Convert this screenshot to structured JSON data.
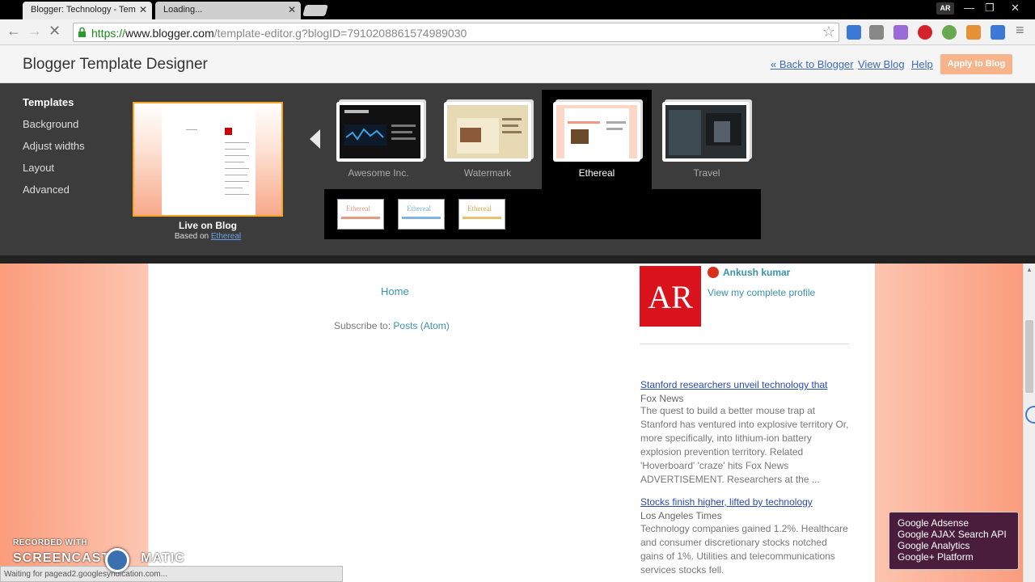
{
  "browser": {
    "tabs": [
      {
        "title": "Blogger: Technology - Tem"
      },
      {
        "title": "Loading..."
      }
    ],
    "profile": "AR",
    "url_scheme": "https://",
    "url_host": "www.blogger.com",
    "url_path": "/template-editor.g?blogID=7910208861574989030",
    "status": "Waiting for pagead2.googlesyndication.com..."
  },
  "header": {
    "title": "Blogger Template Designer",
    "back_link": "« Back to Blogger",
    "view_blog": "View Blog",
    "help": "Help",
    "apply": "Apply to Blog"
  },
  "sidebar": {
    "items": [
      {
        "label": "Templates"
      },
      {
        "label": "Background"
      },
      {
        "label": "Adjust widths"
      },
      {
        "label": "Layout"
      },
      {
        "label": "Advanced"
      }
    ]
  },
  "live": {
    "label": "Live on Blog",
    "based_prefix": "Based on",
    "based_link": "Ethereal"
  },
  "templates": [
    {
      "name": "Awesome Inc."
    },
    {
      "name": "Watermark"
    },
    {
      "name": "Ethereal"
    },
    {
      "name": "Travel"
    }
  ],
  "variants": [
    {
      "label": "Ethereal",
      "color": "#e79a83"
    },
    {
      "label": "Ethereal",
      "color": "#7fb4df"
    },
    {
      "label": "Ethereal",
      "color": "#e9c270"
    }
  ],
  "blog": {
    "home": "Home",
    "subscribe_prefix": "Subscribe to:",
    "subscribe_link": "Posts (Atom)",
    "author": "Ankush kumar",
    "profile_link": "View my complete profile",
    "news": [
      {
        "title": "Stanford researchers unveil technology that",
        "source": "Fox News",
        "body": "The quest to build a better mouse trap at Stanford has ventured into explosive territory Or, more specifically, into lithium-ion battery explosion prevention territory. Related 'Hoverboard' 'craze' hits Fox News ADVERTISEMENT. Researchers at the ..."
      },
      {
        "title": "Stocks finish higher, lifted by technology",
        "source": "Los Angeles Times",
        "body": "Technology companies gained 1.2%. Healthcare and consumer discretionary stocks notched gains of 1%. Utilities and telecommunications services stocks fell."
      }
    ]
  },
  "popup": {
    "items": [
      "Google Adsense",
      "Google AJAX Search API",
      "Google Analytics",
      "Google+ Platform"
    ]
  },
  "watermark": {
    "line1": "RECORDED WITH",
    "line2a": "SCREENCAST",
    "line2b": "MATIC"
  }
}
